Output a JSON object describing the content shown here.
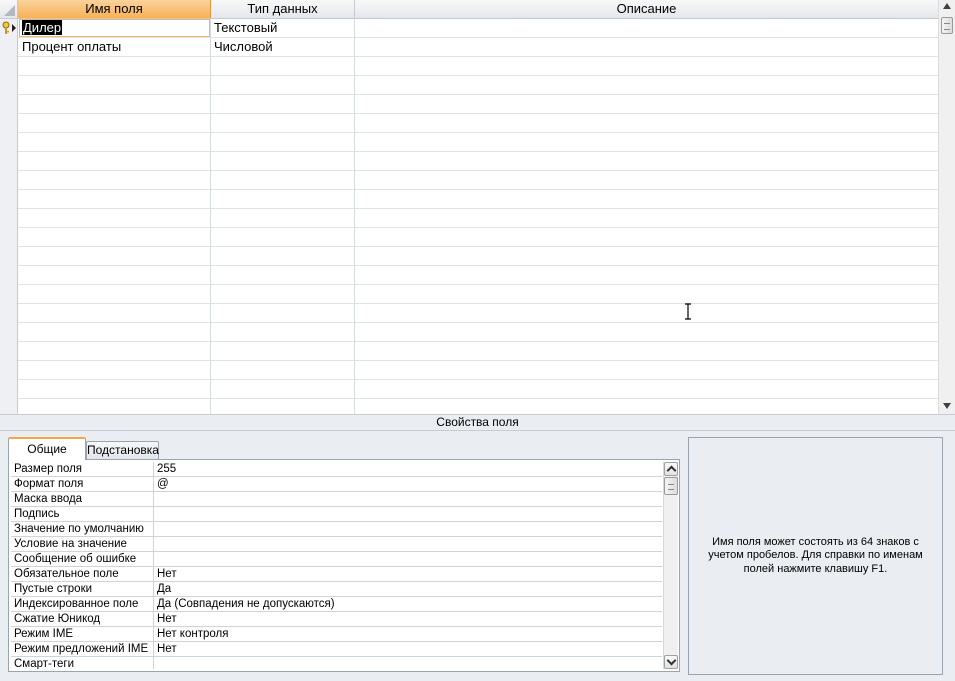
{
  "grid": {
    "columns": [
      {
        "label": "Имя поля",
        "active": true
      },
      {
        "label": "Тип данных",
        "active": false
      },
      {
        "label": "Описание",
        "active": false
      }
    ],
    "rows": [
      {
        "name": "Дилер",
        "type": "Текстовый",
        "description": "",
        "primary_key": true,
        "editing": true
      },
      {
        "name": "Процент оплаты",
        "type": "Числовой",
        "description": "",
        "primary_key": false,
        "editing": false
      }
    ],
    "empty_rows": 19
  },
  "properties": {
    "title": "Свойства поля",
    "tabs": [
      {
        "label": "Общие",
        "active": true
      },
      {
        "label": "Подстановка",
        "active": false
      }
    ],
    "items": [
      {
        "name": "Размер поля",
        "value": "255"
      },
      {
        "name": "Формат поля",
        "value": "@"
      },
      {
        "name": "Маска ввода",
        "value": ""
      },
      {
        "name": "Подпись",
        "value": ""
      },
      {
        "name": "Значение по умолчанию",
        "value": ""
      },
      {
        "name": "Условие на значение",
        "value": ""
      },
      {
        "name": "Сообщение об ошибке",
        "value": ""
      },
      {
        "name": "Обязательное поле",
        "value": "Нет"
      },
      {
        "name": "Пустые строки",
        "value": "Да"
      },
      {
        "name": "Индексированное поле",
        "value": "Да (Совпадения не допускаются)"
      },
      {
        "name": "Сжатие Юникод",
        "value": "Нет"
      },
      {
        "name": "Режим IME",
        "value": "Нет контроля"
      },
      {
        "name": "Режим предложений IME",
        "value": "Нет"
      },
      {
        "name": "Смарт-теги",
        "value": ""
      }
    ],
    "hint": "Имя поля может состоять из 64 знаков с учетом пробелов.  Для справки по именам полей нажмите клавишу F1."
  },
  "icons": {
    "primary_key": "key-icon",
    "row_pointer": "row-pointer-icon",
    "cursor": "text-cursor-icon"
  },
  "colors": {
    "active_header": "#f7b058",
    "edit_outline": "#f2b35e"
  }
}
